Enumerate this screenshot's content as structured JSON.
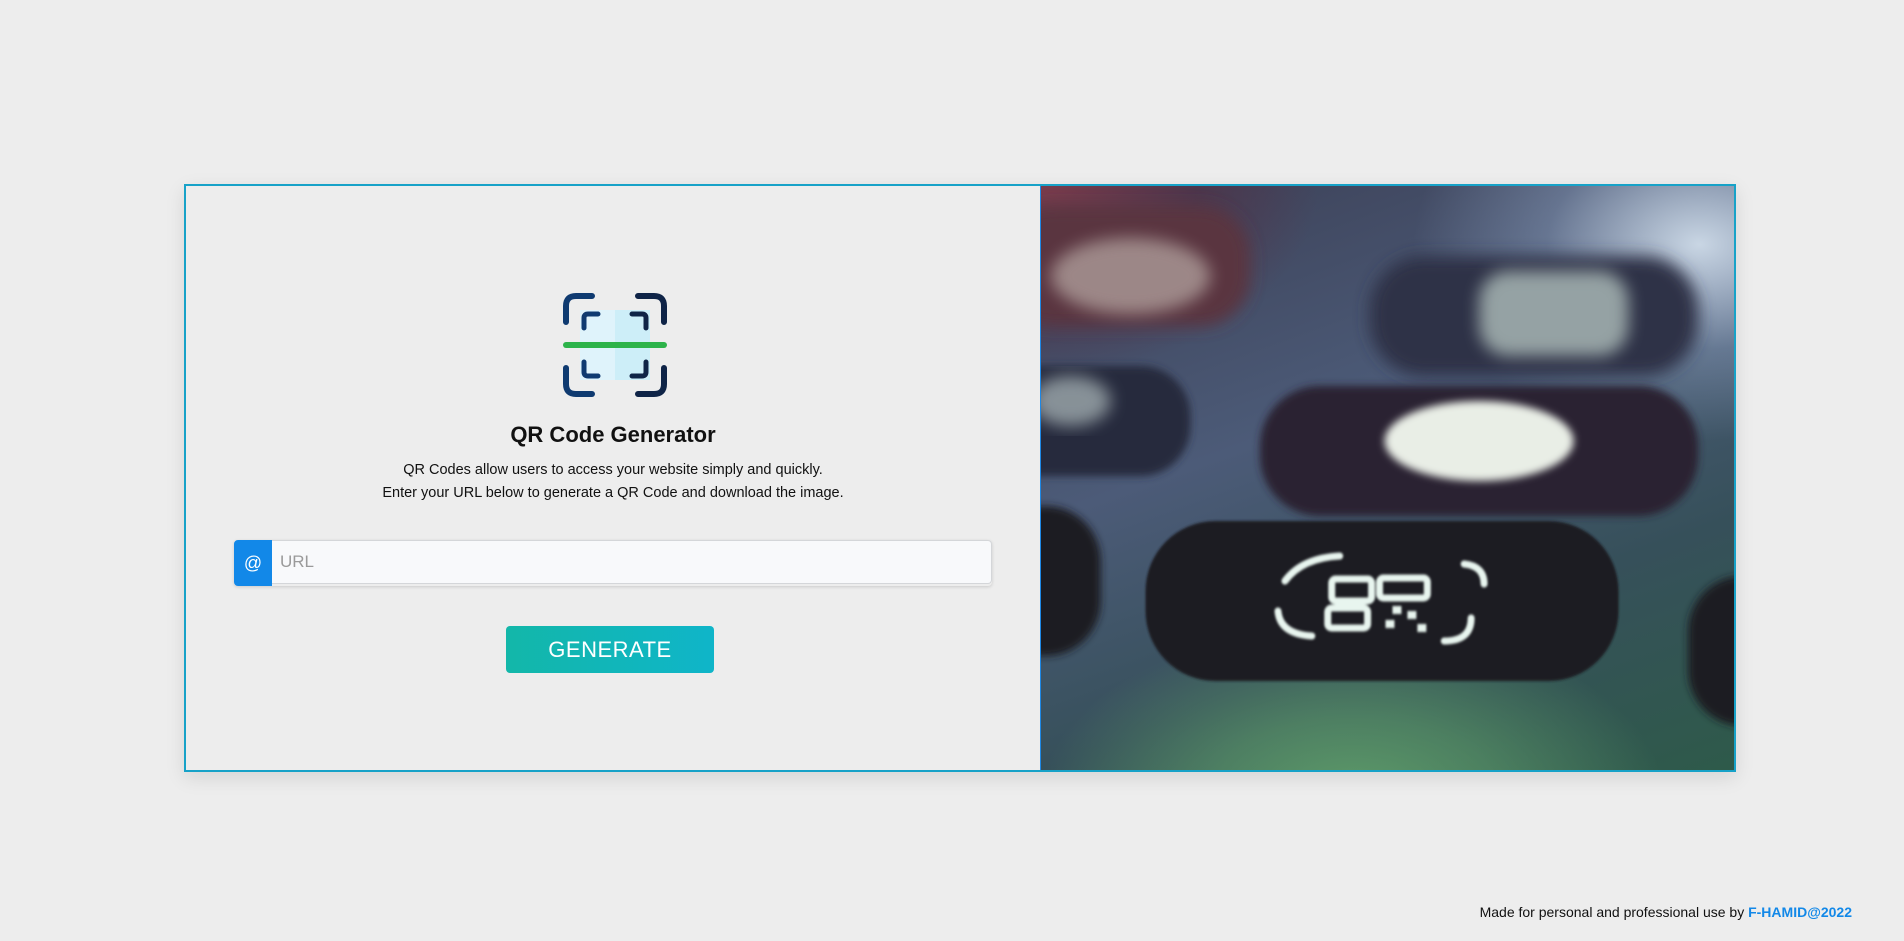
{
  "app": {
    "title": "QR Code Generator",
    "description_line1": "QR Codes allow users to access your website simply and quickly.",
    "description_line2": "Enter your URL below to generate a QR Code and download the image."
  },
  "form": {
    "addon_symbol": "@",
    "url_placeholder": "URL",
    "url_value": "",
    "generate_label": "GENERATE"
  },
  "footer": {
    "text": "Made for personal and professional use by ",
    "brand": "F-HAMID@2022"
  },
  "icons": {
    "logo": "qr-scan-icon",
    "hero_image": "phone-app-qr-scan-image"
  },
  "colors": {
    "accent": "#1288e8",
    "button_gradient_start": "#13b7a9",
    "button_gradient_end": "#0fb5c9",
    "card_border": "#17a2c8",
    "background": "#ededed",
    "scan_line": "#2db34a",
    "logo_navy": "#0f2b5c"
  }
}
